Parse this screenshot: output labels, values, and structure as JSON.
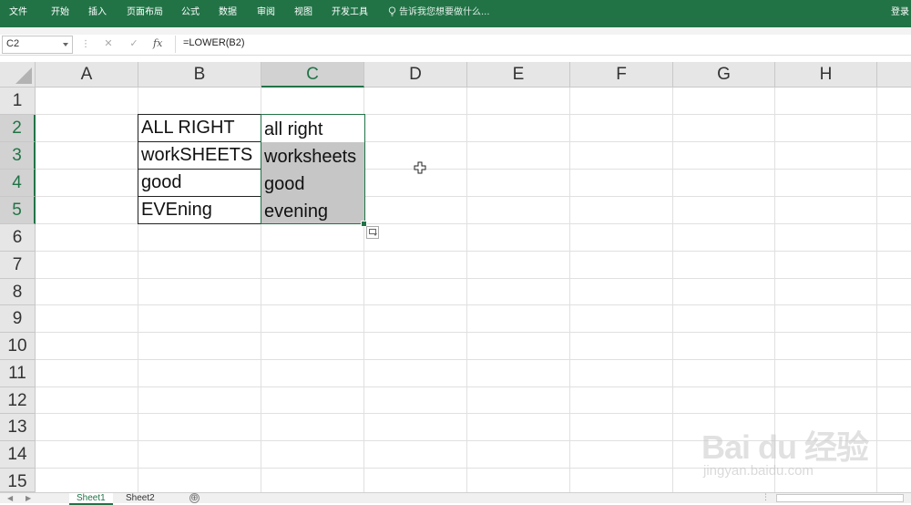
{
  "ribbon": {
    "tabs": [
      "文件",
      "开始",
      "插入",
      "页面布局",
      "公式",
      "数据",
      "审阅",
      "视图",
      "开发工具"
    ],
    "tell_me": "告诉我您想要做什么...",
    "login": "登录",
    "color": "#217346"
  },
  "formula_bar": {
    "name_box": "C2",
    "cancel": "✕",
    "enter": "✓",
    "fx": "fx",
    "formula": "=LOWER(B2)"
  },
  "grid": {
    "columns": [
      "A",
      "B",
      "C",
      "D",
      "E",
      "F",
      "G",
      "H"
    ],
    "selected_column": "C",
    "rows": [
      "1",
      "2",
      "3",
      "4",
      "5",
      "6",
      "7",
      "8",
      "9",
      "10",
      "11",
      "12",
      "13",
      "14",
      "15"
    ],
    "selected_rows": [
      "2",
      "3",
      "4",
      "5"
    ],
    "cells": {
      "B2": "ALL RIGHT",
      "B3": "workSHEETS",
      "B4": "good",
      "B5": "EVEning",
      "C2": "all right",
      "C3": "worksheets",
      "C4": "good",
      "C5": "evening"
    }
  },
  "sheets": {
    "tabs": [
      "Sheet1",
      "Sheet2"
    ],
    "active": "Sheet1",
    "add": "⊕"
  },
  "watermark": {
    "brand": "Bai du 经验",
    "url": "jingyan.baidu.com"
  }
}
